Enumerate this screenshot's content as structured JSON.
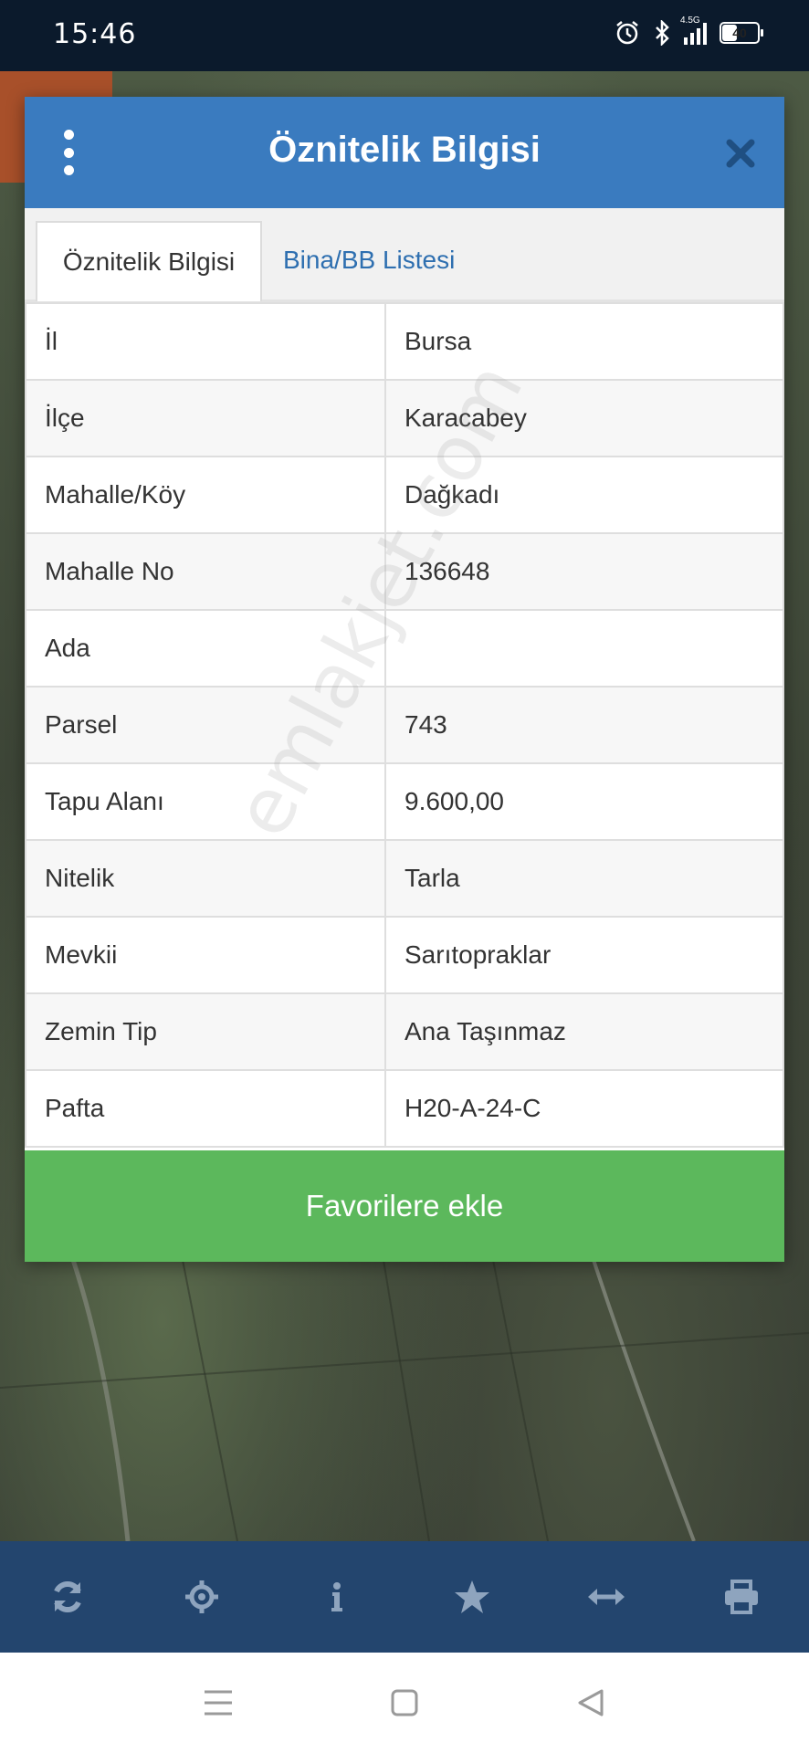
{
  "status_bar": {
    "time": "15:46",
    "network": "4.5G",
    "battery": "40"
  },
  "dialog": {
    "title": "Öznitelik Bilgisi",
    "tabs": [
      {
        "label": "Öznitelik Bilgisi",
        "active": true
      },
      {
        "label": "Bina/BB Listesi",
        "active": false
      }
    ],
    "rows": [
      {
        "key": "İl",
        "value": "Bursa"
      },
      {
        "key": "İlçe",
        "value": "Karacabey"
      },
      {
        "key": "Mahalle/Köy",
        "value": "Dağkadı"
      },
      {
        "key": "Mahalle No",
        "value": "136648"
      },
      {
        "key": "Ada",
        "value": ""
      },
      {
        "key": "Parsel",
        "value": "743"
      },
      {
        "key": "Tapu Alanı",
        "value": "9.600,00"
      },
      {
        "key": "Nitelik",
        "value": "Tarla"
      },
      {
        "key": "Mevkii",
        "value": "Sarıtopraklar"
      },
      {
        "key": "Zemin Tip",
        "value": "Ana Taşınmaz"
      },
      {
        "key": "Pafta",
        "value": "H20-A-24-C"
      }
    ],
    "favorite_button": "Favorilere ekle"
  },
  "watermark": "emlakjet.com",
  "toolbar": {
    "items": [
      "refresh-icon",
      "locate-icon",
      "info-icon",
      "star-icon",
      "measure-icon",
      "print-icon"
    ]
  },
  "colors": {
    "header": "#3a7bbf",
    "toolbar": "#23456e",
    "button_green": "#5cb85c",
    "tab_link": "#2e6fb0"
  }
}
